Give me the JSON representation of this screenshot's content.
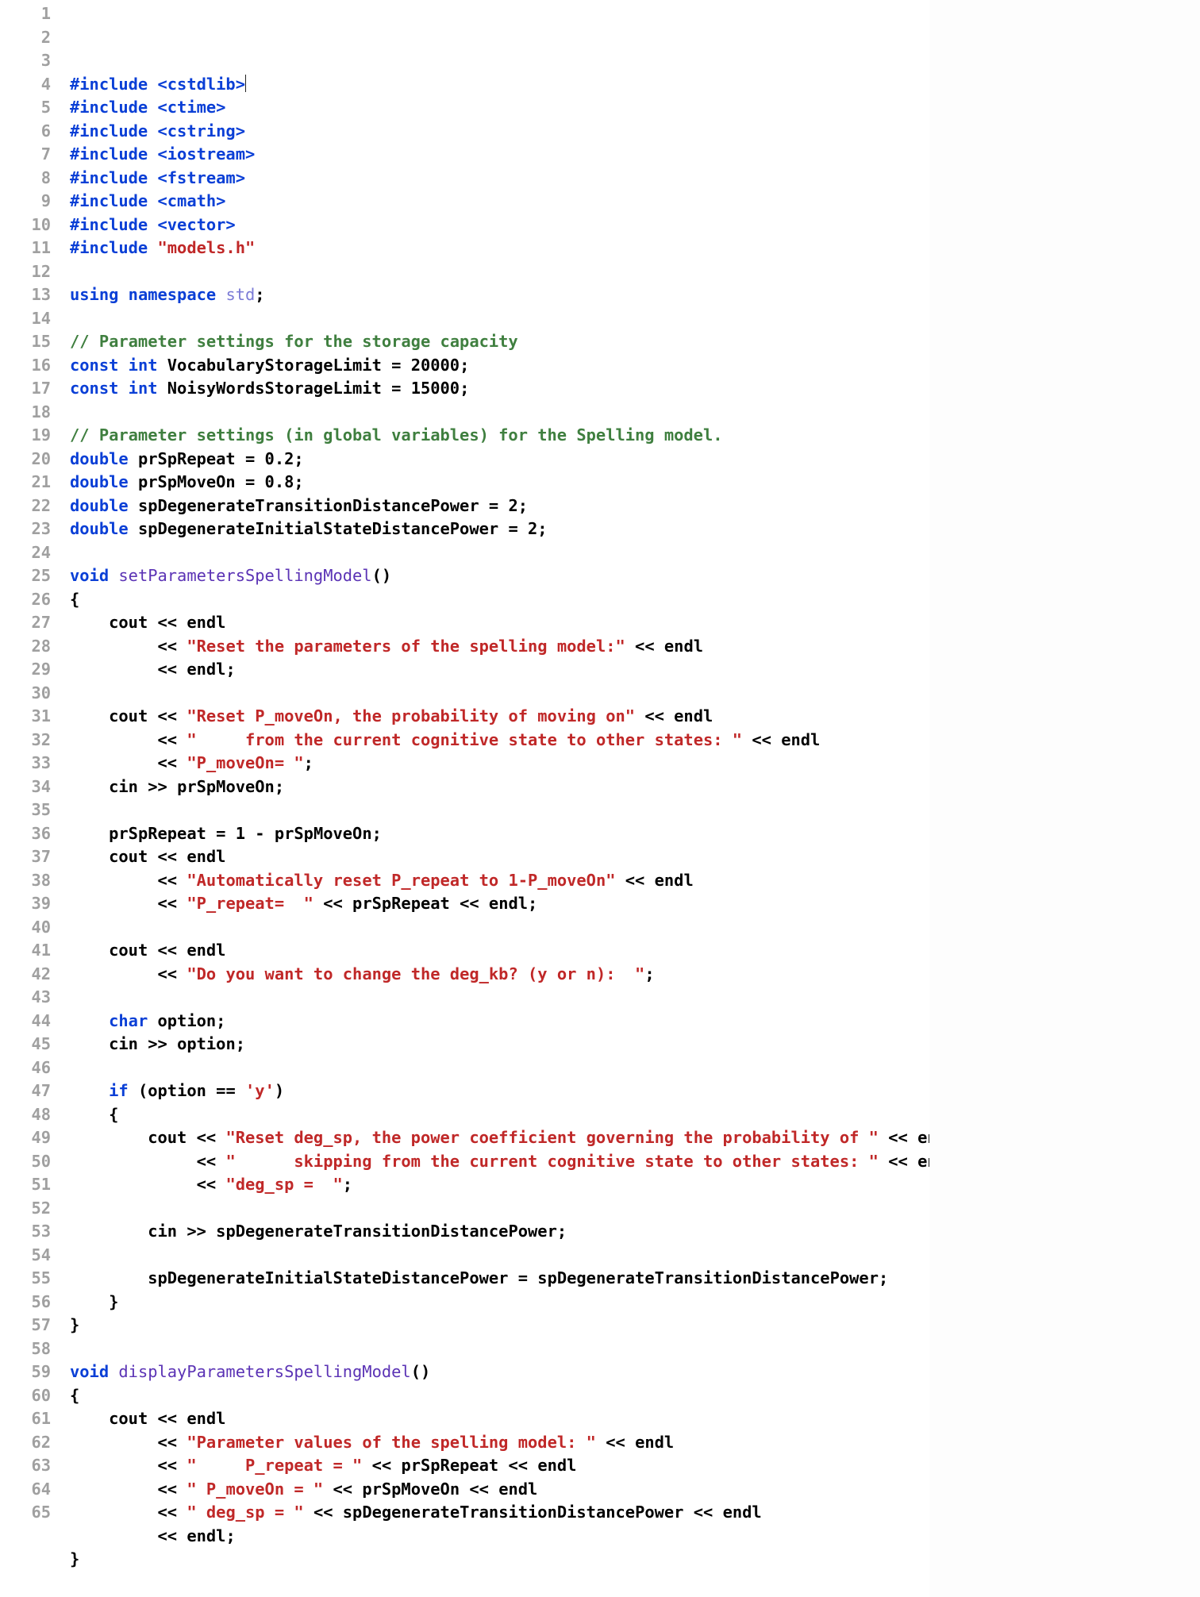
{
  "editor": {
    "line_start": 1,
    "lines": [
      [
        [
          "kw",
          "#include "
        ],
        [
          "kw",
          "<cstdlib>"
        ],
        [
          "caret",
          ""
        ]
      ],
      [
        [
          "kw",
          "#include "
        ],
        [
          "kw",
          "<ctime>"
        ]
      ],
      [
        [
          "kw",
          "#include "
        ],
        [
          "kw",
          "<cstring>"
        ]
      ],
      [
        [
          "kw",
          "#include "
        ],
        [
          "kw",
          "<iostream>"
        ]
      ],
      [
        [
          "kw",
          "#include "
        ],
        [
          "kw",
          "<fstream>"
        ]
      ],
      [
        [
          "kw",
          "#include "
        ],
        [
          "kw",
          "<cmath>"
        ]
      ],
      [
        [
          "kw",
          "#include "
        ],
        [
          "kw",
          "<vector>"
        ]
      ],
      [
        [
          "kw",
          "#include "
        ],
        [
          "st",
          "\"models.h\""
        ]
      ],
      [],
      [
        [
          "kw",
          "using "
        ],
        [
          "kw",
          "namespace "
        ],
        [
          "ns",
          "std"
        ],
        [
          "op",
          ";"
        ]
      ],
      [],
      [
        [
          "cm",
          "// Parameter settings for the storage capacity"
        ]
      ],
      [
        [
          "kw",
          "const "
        ],
        [
          "ty",
          "int "
        ],
        [
          "id",
          "VocabularyStorageLimit"
        ],
        [
          "op",
          " = "
        ],
        [
          "nu",
          "20000"
        ],
        [
          "op",
          ";"
        ]
      ],
      [
        [
          "kw",
          "const "
        ],
        [
          "ty",
          "int "
        ],
        [
          "id",
          "NoisyWordsStorageLimit"
        ],
        [
          "op",
          " = "
        ],
        [
          "nu",
          "15000"
        ],
        [
          "op",
          ";"
        ]
      ],
      [],
      [
        [
          "cm",
          "// Parameter settings (in global variables) for the Spelling model."
        ]
      ],
      [
        [
          "ty",
          "double "
        ],
        [
          "id",
          "prSpRepeat"
        ],
        [
          "op",
          " = "
        ],
        [
          "nu",
          "0.2"
        ],
        [
          "op",
          ";"
        ]
      ],
      [
        [
          "ty",
          "double "
        ],
        [
          "id",
          "prSpMoveOn"
        ],
        [
          "op",
          " = "
        ],
        [
          "nu",
          "0.8"
        ],
        [
          "op",
          ";"
        ]
      ],
      [
        [
          "ty",
          "double "
        ],
        [
          "id",
          "spDegenerateTransitionDistancePower"
        ],
        [
          "op",
          " = "
        ],
        [
          "nu",
          "2"
        ],
        [
          "op",
          ";"
        ]
      ],
      [
        [
          "ty",
          "double "
        ],
        [
          "id",
          "spDegenerateInitialStateDistancePower"
        ],
        [
          "op",
          " = "
        ],
        [
          "nu",
          "2"
        ],
        [
          "op",
          ";"
        ]
      ],
      [],
      [
        [
          "ty",
          "void "
        ],
        [
          "fn",
          "setParametersSpellingModel"
        ],
        [
          "op",
          "()"
        ]
      ],
      [
        [
          "op",
          "{"
        ]
      ],
      [
        [
          "pl",
          "    "
        ],
        [
          "id",
          "cout"
        ],
        [
          "op",
          " << "
        ],
        [
          "id",
          "endl"
        ]
      ],
      [
        [
          "pl",
          "         "
        ],
        [
          "op",
          "<< "
        ],
        [
          "st",
          "\"Reset the parameters of the spelling model:\""
        ],
        [
          "op",
          " << "
        ],
        [
          "id",
          "endl"
        ]
      ],
      [
        [
          "pl",
          "         "
        ],
        [
          "op",
          "<< "
        ],
        [
          "id",
          "endl"
        ],
        [
          "op",
          ";"
        ]
      ],
      [],
      [
        [
          "pl",
          "    "
        ],
        [
          "id",
          "cout"
        ],
        [
          "op",
          " << "
        ],
        [
          "st",
          "\"Reset P_moveOn, the probability of moving on\""
        ],
        [
          "op",
          " << "
        ],
        [
          "id",
          "endl"
        ]
      ],
      [
        [
          "pl",
          "         "
        ],
        [
          "op",
          "<< "
        ],
        [
          "st",
          "\"     from the current cognitive state to other states: \""
        ],
        [
          "op",
          " << "
        ],
        [
          "id",
          "endl"
        ]
      ],
      [
        [
          "pl",
          "         "
        ],
        [
          "op",
          "<< "
        ],
        [
          "st",
          "\"P_moveOn= \""
        ],
        [
          "op",
          ";"
        ]
      ],
      [
        [
          "pl",
          "    "
        ],
        [
          "id",
          "cin"
        ],
        [
          "op",
          " >> "
        ],
        [
          "id",
          "prSpMoveOn"
        ],
        [
          "op",
          ";"
        ]
      ],
      [],
      [
        [
          "pl",
          "    "
        ],
        [
          "id",
          "prSpRepeat"
        ],
        [
          "op",
          " = "
        ],
        [
          "nu",
          "1"
        ],
        [
          "op",
          " - "
        ],
        [
          "id",
          "prSpMoveOn"
        ],
        [
          "op",
          ";"
        ]
      ],
      [
        [
          "pl",
          "    "
        ],
        [
          "id",
          "cout"
        ],
        [
          "op",
          " << "
        ],
        [
          "id",
          "endl"
        ]
      ],
      [
        [
          "pl",
          "         "
        ],
        [
          "op",
          "<< "
        ],
        [
          "st",
          "\"Automatically reset P_repeat to 1-P_moveOn\""
        ],
        [
          "op",
          " << "
        ],
        [
          "id",
          "endl"
        ]
      ],
      [
        [
          "pl",
          "         "
        ],
        [
          "op",
          "<< "
        ],
        [
          "st",
          "\"P_repeat=  \""
        ],
        [
          "op",
          " << "
        ],
        [
          "id",
          "prSpRepeat"
        ],
        [
          "op",
          " << "
        ],
        [
          "id",
          "endl"
        ],
        [
          "op",
          ";"
        ]
      ],
      [],
      [
        [
          "pl",
          "    "
        ],
        [
          "id",
          "cout"
        ],
        [
          "op",
          " << "
        ],
        [
          "id",
          "endl"
        ]
      ],
      [
        [
          "pl",
          "         "
        ],
        [
          "op",
          "<< "
        ],
        [
          "st",
          "\"Do you want to change the deg_kb? (y or n):  \""
        ],
        [
          "op",
          ";"
        ]
      ],
      [],
      [
        [
          "pl",
          "    "
        ],
        [
          "ty",
          "char "
        ],
        [
          "id",
          "option"
        ],
        [
          "op",
          ";"
        ]
      ],
      [
        [
          "pl",
          "    "
        ],
        [
          "id",
          "cin"
        ],
        [
          "op",
          " >> "
        ],
        [
          "id",
          "option"
        ],
        [
          "op",
          ";"
        ]
      ],
      [],
      [
        [
          "pl",
          "    "
        ],
        [
          "kw",
          "if "
        ],
        [
          "op",
          "("
        ],
        [
          "id",
          "option"
        ],
        [
          "op",
          " == "
        ],
        [
          "ch",
          "'y'"
        ],
        [
          "op",
          ")"
        ]
      ],
      [
        [
          "pl",
          "    "
        ],
        [
          "op",
          "{"
        ]
      ],
      [
        [
          "pl",
          "        "
        ],
        [
          "id",
          "cout"
        ],
        [
          "op",
          " << "
        ],
        [
          "st",
          "\"Reset deg_sp, the power coefficient governing the probability of \""
        ],
        [
          "op",
          " << "
        ],
        [
          "id",
          "endl"
        ]
      ],
      [
        [
          "pl",
          "             "
        ],
        [
          "op",
          "<< "
        ],
        [
          "st",
          "\"      skipping from the current cognitive state to other states: \""
        ],
        [
          "op",
          " << "
        ],
        [
          "id",
          "endl"
        ]
      ],
      [
        [
          "pl",
          "             "
        ],
        [
          "op",
          "<< "
        ],
        [
          "st",
          "\"deg_sp =  \""
        ],
        [
          "op",
          ";"
        ]
      ],
      [],
      [
        [
          "pl",
          "        "
        ],
        [
          "id",
          "cin"
        ],
        [
          "op",
          " >> "
        ],
        [
          "id",
          "spDegenerateTransitionDistancePower"
        ],
        [
          "op",
          ";"
        ]
      ],
      [],
      [
        [
          "pl",
          "        "
        ],
        [
          "id",
          "spDegenerateInitialStateDistancePower"
        ],
        [
          "op",
          " = "
        ],
        [
          "id",
          "spDegenerateTransitionDistancePower"
        ],
        [
          "op",
          ";"
        ]
      ],
      [
        [
          "pl",
          "    "
        ],
        [
          "op",
          "}"
        ]
      ],
      [
        [
          "op",
          "}"
        ]
      ],
      [],
      [
        [
          "ty",
          "void "
        ],
        [
          "fn",
          "displayParametersSpellingModel"
        ],
        [
          "op",
          "()"
        ]
      ],
      [
        [
          "op",
          "{"
        ]
      ],
      [
        [
          "pl",
          "    "
        ],
        [
          "id",
          "cout"
        ],
        [
          "op",
          " << "
        ],
        [
          "id",
          "endl"
        ]
      ],
      [
        [
          "pl",
          "         "
        ],
        [
          "op",
          "<< "
        ],
        [
          "st",
          "\"Parameter values of the spelling model: \""
        ],
        [
          "op",
          " << "
        ],
        [
          "id",
          "endl"
        ]
      ],
      [
        [
          "pl",
          "         "
        ],
        [
          "op",
          "<< "
        ],
        [
          "st",
          "\"     P_repeat = \""
        ],
        [
          "op",
          " << "
        ],
        [
          "id",
          "prSpRepeat"
        ],
        [
          "op",
          " << "
        ],
        [
          "id",
          "endl"
        ]
      ],
      [
        [
          "pl",
          "         "
        ],
        [
          "op",
          "<< "
        ],
        [
          "st",
          "\" P_moveOn = \""
        ],
        [
          "op",
          " << "
        ],
        [
          "id",
          "prSpMoveOn"
        ],
        [
          "op",
          " << "
        ],
        [
          "id",
          "endl"
        ]
      ],
      [
        [
          "pl",
          "         "
        ],
        [
          "op",
          "<< "
        ],
        [
          "st",
          "\" deg_sp = \""
        ],
        [
          "op",
          " << "
        ],
        [
          "id",
          "spDegenerateTransitionDistancePower"
        ],
        [
          "op",
          " << "
        ],
        [
          "id",
          "endl"
        ]
      ],
      [
        [
          "pl",
          "         "
        ],
        [
          "op",
          "<< "
        ],
        [
          "id",
          "endl"
        ],
        [
          "op",
          ";"
        ]
      ],
      [
        [
          "op",
          "}"
        ]
      ],
      []
    ]
  }
}
